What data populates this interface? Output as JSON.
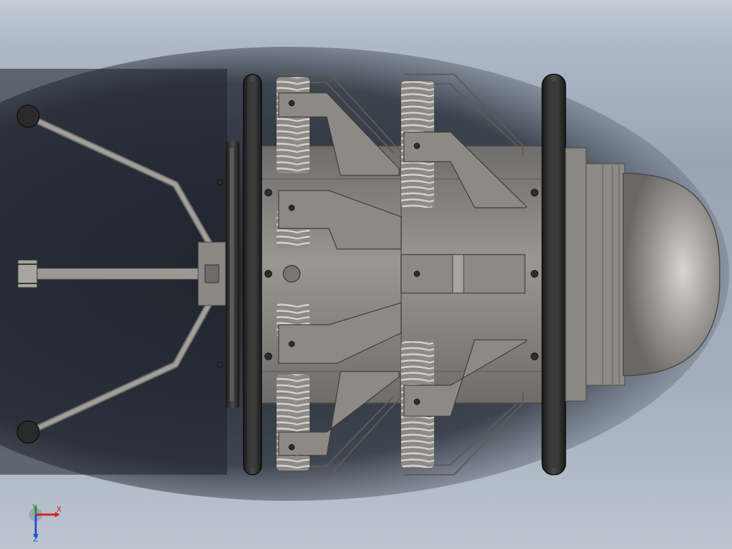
{
  "scene": {
    "background_top": "#c4ccd8",
    "background_bottom": "#9aa5b4",
    "model_body_color": "#8f8c88",
    "model_dark_color": "#2a2a2a",
    "spring_color": "#b5b2ae"
  },
  "triad": {
    "x_label": "X",
    "y_label": "Y",
    "z_label": "Z",
    "x_color": "#d02020",
    "y_color": "#1a9a1a",
    "z_color": "#2050d0"
  }
}
